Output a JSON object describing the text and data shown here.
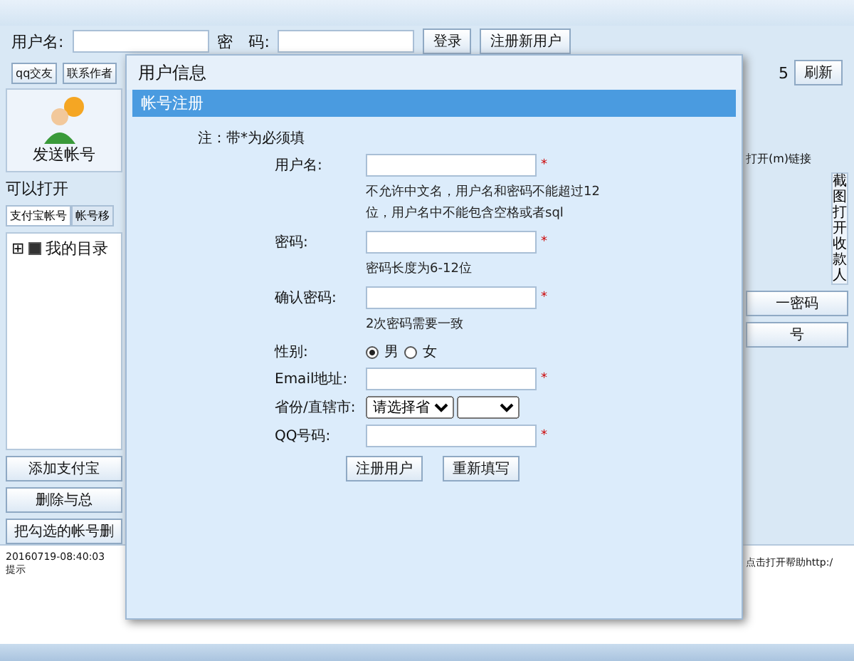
{
  "main": {
    "login": {
      "username_label": "用户名:",
      "password_label": "密　码:",
      "login_button": "登录",
      "register_button": "注册新用户"
    },
    "toolbar": {
      "buttons": [
        "qq交友",
        "联系作者"
      ],
      "spinner": "5",
      "refresh": "刷新"
    },
    "left": {
      "send_label": "发送帐号",
      "open_note": "可以打开",
      "tabs": [
        {
          "label": "支付宝帐号",
          "selected": true
        },
        {
          "label": "帐号移",
          "selected": false
        }
      ],
      "tree": [
        {
          "label": "我的目录",
          "checked": true,
          "toggle": "⊞"
        }
      ],
      "buttons": [
        "添加支付宝",
        "删除与总",
        "把勾选的帐号删"
      ]
    },
    "right": {
      "link_text": "打开(m)链接",
      "vertical_tab": "截图打开收款人",
      "buttons": [
        "一密码",
        "号"
      ]
    },
    "log": {
      "time": "20160719-08:40:03",
      "message": "提示",
      "help": "点击打开帮助http:/"
    }
  },
  "dialog": {
    "title": "用户信息",
    "section": "帐号注册",
    "note": "注：带*为必须填",
    "rows": [
      {
        "kind": "input",
        "label": "用户名:",
        "mark": "*"
      },
      {
        "kind": "hint",
        "text": "不允许中文名，用户名和密码不能超过12位，用户名中不能包含空格或者sql"
      },
      {
        "kind": "input",
        "label": "密码:",
        "mark": "*"
      },
      {
        "kind": "hint",
        "text": "密码长度为6-12位"
      },
      {
        "kind": "input",
        "label": "确认密码:",
        "mark": "*"
      },
      {
        "kind": "hint",
        "text": "2次密码需要一致"
      },
      {
        "kind": "radio",
        "label": "性别:",
        "options": [
          {
            "label": "男",
            "selected": true
          },
          {
            "label": "女",
            "selected": false
          }
        ]
      },
      {
        "kind": "input",
        "label": "Email地址:",
        "mark": "*"
      },
      {
        "kind": "select",
        "label": "省份/直辖市:",
        "selects": [
          {
            "kind": "filled",
            "value": "请选择省"
          },
          {
            "kind": "blank"
          }
        ]
      },
      {
        "kind": "input",
        "label": "QQ号码:",
        "mark": "*"
      }
    ],
    "buttons": [
      "注册用户",
      "重新填写"
    ]
  }
}
